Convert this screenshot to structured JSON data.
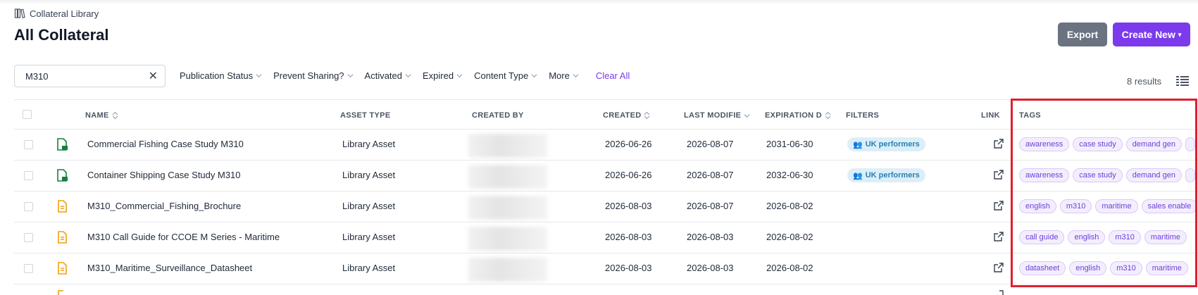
{
  "breadcrumb": {
    "label": "Collateral Library"
  },
  "page": {
    "title": "All Collateral"
  },
  "toolbar": {
    "export_label": "Export",
    "create_label": "Create New"
  },
  "search": {
    "value": "M310"
  },
  "filters": {
    "items": [
      "Publication Status",
      "Prevent Sharing?",
      "Activated",
      "Expired",
      "Content Type",
      "More"
    ],
    "clear_all": "Clear All"
  },
  "results": {
    "count_label": "8 results"
  },
  "table": {
    "headers": {
      "name": "NAME",
      "asset_type": "ASSET TYPE",
      "created_by": "CREATED BY",
      "created": "CREATED",
      "last_modified": "LAST MODIFIE",
      "expiration": "EXPIRATION D",
      "filters": "FILTERS",
      "link": "LINK",
      "tags": "TAGS"
    },
    "rows": [
      {
        "icon": "file-green-icon",
        "name": "Commercial Fishing Case Study M310",
        "asset_type": "Library Asset",
        "created": "2026-06-26",
        "last_modified": "2026-08-07",
        "expiration": "2031-06-30",
        "filter_badge": "UK performers",
        "tags": [
          "awareness",
          "case study",
          "demand gen",
          ""
        ]
      },
      {
        "icon": "file-green-icon",
        "name": "Container Shipping Case Study M310",
        "asset_type": "Library Asset",
        "created": "2026-06-26",
        "last_modified": "2026-08-07",
        "expiration": "2032-06-30",
        "filter_badge": "UK performers",
        "tags": [
          "awareness",
          "case study",
          "demand gen",
          ""
        ]
      },
      {
        "icon": "file-orange-icon",
        "name": "M310_Commercial_Fishing_Brochure",
        "asset_type": "Library Asset",
        "created": "2026-08-03",
        "last_modified": "2026-08-07",
        "expiration": "2026-08-02",
        "filter_badge": "",
        "tags": [
          "english",
          "m310",
          "maritime",
          "sales enable"
        ]
      },
      {
        "icon": "file-orange-icon",
        "name": "M310 Call Guide for CCOE M Series - Maritime",
        "asset_type": "Library Asset",
        "created": "2026-08-03",
        "last_modified": "2026-08-03",
        "expiration": "2026-08-02",
        "filter_badge": "",
        "tags": [
          "call guide",
          "english",
          "m310",
          "maritime"
        ]
      },
      {
        "icon": "file-orange-icon",
        "name": "M310_Maritime_Surveillance_Datasheet",
        "asset_type": "Library Asset",
        "created": "2026-08-03",
        "last_modified": "2026-08-03",
        "expiration": "2026-08-02",
        "filter_badge": "",
        "tags": [
          "datasheet",
          "english",
          "m310",
          "maritime"
        ]
      }
    ]
  },
  "colors": {
    "accent": "#7c3aed",
    "highlight": "#e01e2e",
    "export_bg": "#6b7280"
  }
}
